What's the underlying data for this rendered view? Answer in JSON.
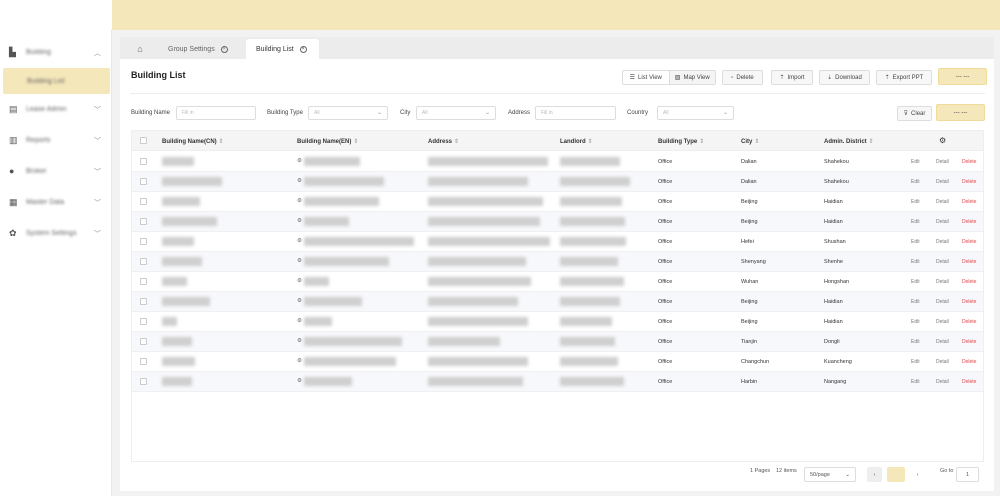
{
  "sidebar": {
    "items": [
      {
        "label": "Building",
        "icon": "building-icon"
      },
      {
        "label": "Building List",
        "icon": ""
      },
      {
        "label": "Lease Admin",
        "icon": "document-icon"
      },
      {
        "label": "Reports",
        "icon": "chart-icon"
      },
      {
        "label": "Broker",
        "icon": "user-icon"
      },
      {
        "label": "Master Data",
        "icon": "database-icon"
      },
      {
        "label": "System Settings",
        "icon": "gear-icon"
      }
    ]
  },
  "tabs": [
    {
      "label": "Group Settings"
    },
    {
      "label": "Building List"
    }
  ],
  "page": {
    "title": "Building List"
  },
  "toolbar": {
    "list_view": "List View",
    "map_view": "Map View",
    "delete": "Delete",
    "import": "Import",
    "download": "Download",
    "export_ppt": "Export PPT",
    "extra": "--- ---"
  },
  "filters": {
    "building_name_label": "Building Name",
    "building_name_ph": "Fill in",
    "building_type_label": "Building Type",
    "building_type_val": "All",
    "city_label": "City",
    "city_val": "All",
    "address_label": "Address",
    "address_ph": "Fill in",
    "country_label": "Country",
    "country_val": "All",
    "clear": "Clear",
    "extra": "--- ---"
  },
  "table": {
    "headers": [
      "Building Name(CN)",
      "Building Name(EN)",
      "Address",
      "Landlord",
      "Building Type",
      "City",
      "Admin. District"
    ],
    "actions": {
      "edit": "Edit",
      "detail": "Detail",
      "delete": "Delete"
    },
    "rows": [
      {
        "type": "Office",
        "city": "Dalian",
        "district": "Shahekou"
      },
      {
        "type": "Office",
        "city": "Dalian",
        "district": "Shahekou"
      },
      {
        "type": "Office",
        "city": "Beijing",
        "district": "Haidian"
      },
      {
        "type": "Office",
        "city": "Beijing",
        "district": "Haidian"
      },
      {
        "type": "Office",
        "city": "Hefei",
        "district": "Shushan"
      },
      {
        "type": "Office",
        "city": "Shenyang",
        "district": "Shenhe"
      },
      {
        "type": "Office",
        "city": "Wuhan",
        "district": "Hongshan"
      },
      {
        "type": "Office",
        "city": "Beijing",
        "district": "Haidian"
      },
      {
        "type": "Office",
        "city": "Beijing",
        "district": "Haidian"
      },
      {
        "type": "Office",
        "city": "Tianjin",
        "district": "Dongli"
      },
      {
        "type": "Office",
        "city": "Changchun",
        "district": "Kuancheng"
      },
      {
        "type": "Office",
        "city": "Harbin",
        "district": "Nangang"
      }
    ]
  },
  "pagination": {
    "pages": "1 Pages",
    "items": "12 items",
    "page_size": "50/page",
    "goto_label": "Go to",
    "goto_val": "1"
  }
}
